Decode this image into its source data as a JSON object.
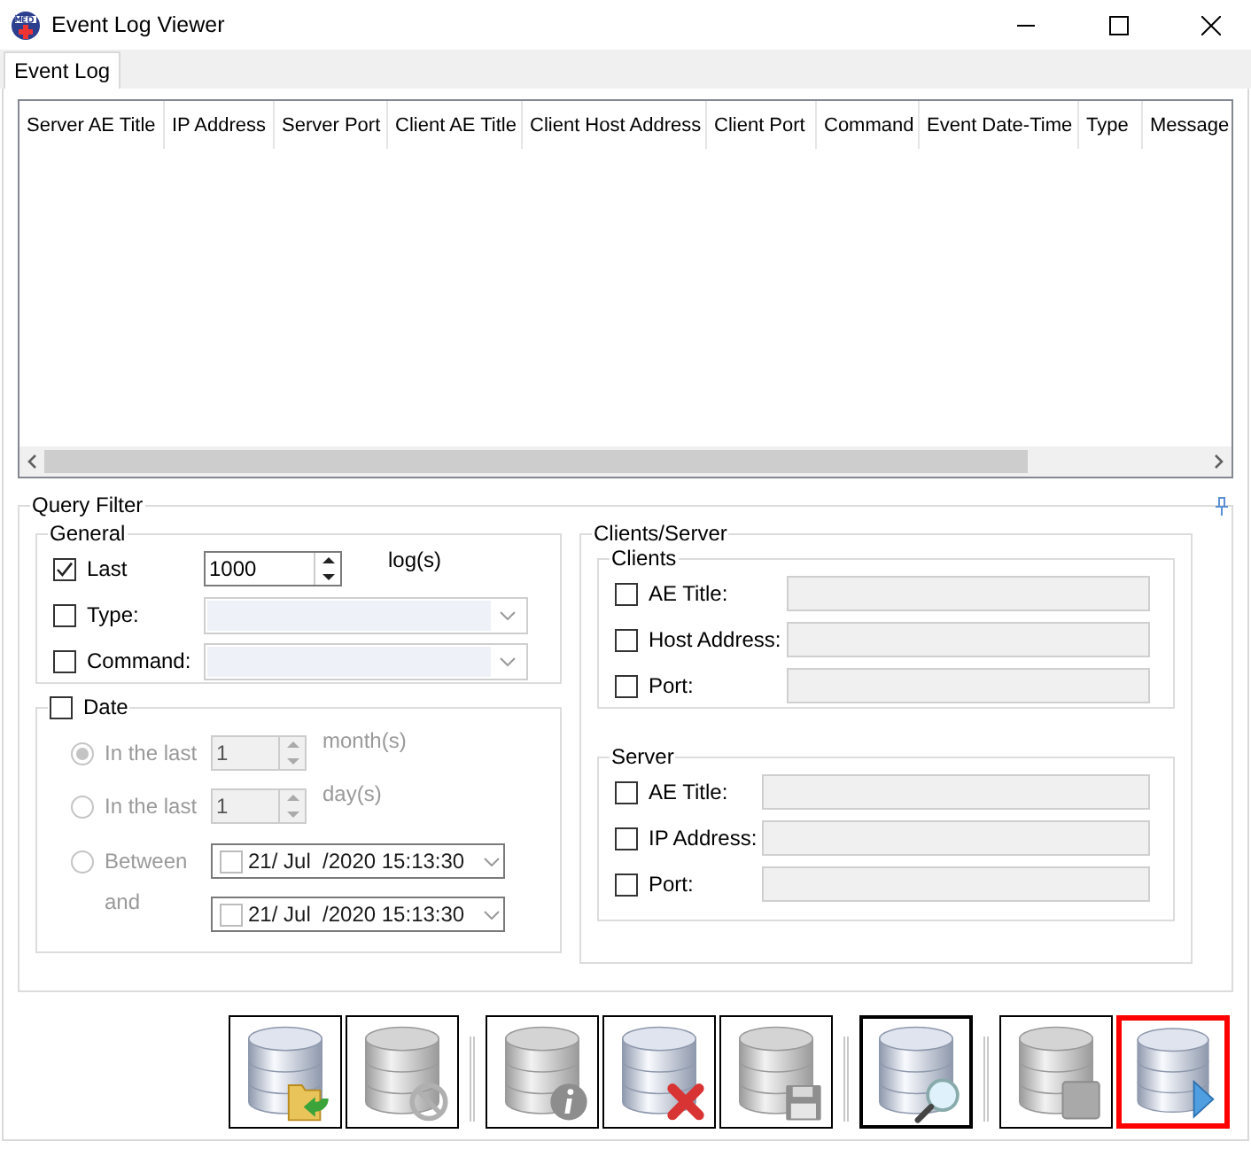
{
  "window": {
    "title": "Event Log Viewer"
  },
  "tabs": [
    {
      "label": "Event Log",
      "selected": true
    }
  ],
  "table": {
    "columns": [
      "Server AE Title",
      "IP Address",
      "Server Port",
      "Client AE Title",
      "Client Host Address",
      "Client Port",
      "Command",
      "Event Date-Time",
      "Type",
      "Message"
    ]
  },
  "query_filter": {
    "title": "Query Filter",
    "general": {
      "title": "General",
      "rows": [
        {
          "kind": "spin",
          "label": "Last",
          "checked": true,
          "value": "1000",
          "unit": "log(s)"
        },
        {
          "kind": "combo",
          "label": "Type:",
          "checked": false
        },
        {
          "kind": "combo",
          "label": "Command:",
          "checked": false
        }
      ]
    },
    "date": {
      "label": "Date",
      "checked": false,
      "options": [
        {
          "kind": "spin",
          "label": "In the last",
          "selected": true,
          "value": "1",
          "unit": "month(s)"
        },
        {
          "kind": "spin",
          "label": "In the last",
          "selected": false,
          "value": "1",
          "unit": "day(s)"
        },
        {
          "kind": "date",
          "label": "Between",
          "selected": false,
          "value": "21/ Jul  /2020 15:13:30"
        }
      ],
      "end_date": {
        "label": "and",
        "value": "21/ Jul  /2020 15:13:30"
      }
    },
    "clients_server": {
      "title": "Clients/Server",
      "clients": {
        "title": "Clients",
        "fields": [
          {
            "label": "AE Title:",
            "checked": false
          },
          {
            "label": "Host Address:",
            "checked": false
          },
          {
            "label": "Port:",
            "checked": false
          }
        ]
      },
      "server": {
        "title": "Server",
        "fields": [
          {
            "label": "AE Title:",
            "checked": false
          },
          {
            "label": "IP Address:",
            "checked": false
          },
          {
            "label": "Port:",
            "checked": false
          }
        ]
      }
    }
  },
  "toolbar": {
    "groups": [
      [
        {
          "kind": "open",
          "disabled": false,
          "focused": false,
          "highlighted": false
        },
        {
          "kind": "cancel",
          "disabled": true,
          "focused": false,
          "highlighted": false
        }
      ],
      [
        {
          "kind": "info",
          "disabled": true,
          "focused": false,
          "highlighted": false
        },
        {
          "kind": "delete",
          "disabled": false,
          "focused": false,
          "highlighted": false
        },
        {
          "kind": "save",
          "disabled": true,
          "focused": false,
          "highlighted": false
        }
      ],
      [
        {
          "kind": "search",
          "disabled": false,
          "focused": true,
          "highlighted": false
        }
      ],
      [
        {
          "kind": "stop",
          "disabled": true,
          "focused": false,
          "highlighted": false
        },
        {
          "kind": "run",
          "disabled": false,
          "focused": false,
          "highlighted": true
        }
      ]
    ]
  }
}
